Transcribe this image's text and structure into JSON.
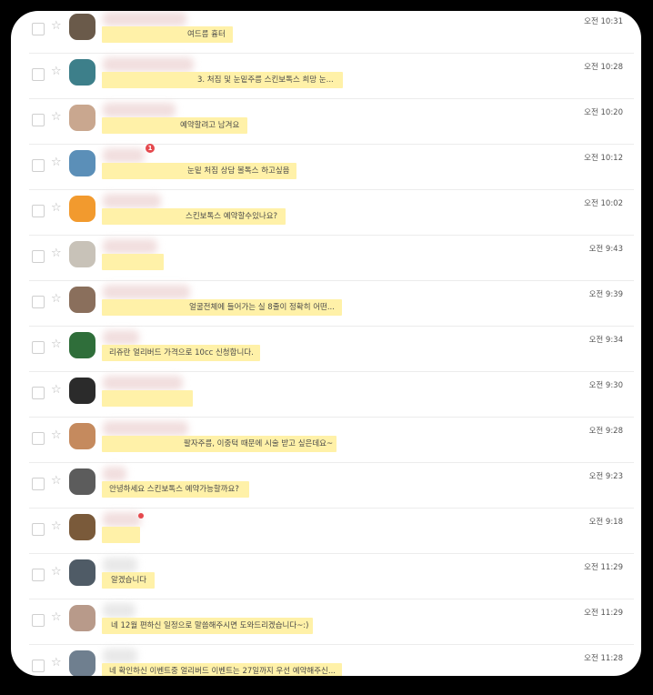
{
  "messages": [
    {
      "text": "여드름 흉터",
      "time": "오전 10:31",
      "avatar": "#6a5a4a",
      "badge": ""
    },
    {
      "text": "3. 처짐 및 눈밑주름 스킨보톡스 희망 눈...",
      "time": "오전 10:28",
      "avatar": "#3d7f8a",
      "badge": ""
    },
    {
      "text": "예약할려고 남겨요",
      "time": "오전 10:20",
      "avatar": "#c9a78f",
      "badge": ""
    },
    {
      "text": "눈밑 처짐 상담 볼톡스 하고싶음",
      "time": "오전 10:12",
      "avatar": "#5b8fb8",
      "badge": "1"
    },
    {
      "text": "스킨보톡스 예약할수있나요?",
      "time": "오전 10:02",
      "avatar": "#f29a2e",
      "badge": ""
    },
    {
      "text": "",
      "time": "오전 9:43",
      "avatar": "#c8c2b8",
      "badge": ""
    },
    {
      "text": "얼굴전체에 들어가는 실 8줄이 정확히 어떤...",
      "time": "오전 9:39",
      "avatar": "#8a6f5c",
      "badge": ""
    },
    {
      "text": "리쥬란 얼리버드 가격으로 10cc 신청합니다.",
      "time": "오전 9:34",
      "avatar": "#2f6e3a",
      "badge": ""
    },
    {
      "text": "",
      "time": "오전 9:30",
      "avatar": "#2b2b2b",
      "badge": ""
    },
    {
      "text": "팔자주름, 이중턱 때문에 시술 받고 싶은데요~",
      "time": "오전 9:28",
      "avatar": "#c58a5e",
      "badge": ""
    },
    {
      "text": "안녕하세요 스킨보톡스 예약가능할까요?",
      "time": "오전 9:23",
      "avatar": "#5c5c5c",
      "badge": ""
    },
    {
      "text": "",
      "time": "오전 9:18",
      "avatar": "#7a5a3a",
      "badge": "dot"
    },
    {
      "text": "알겠습니다",
      "time": "오전 11:29",
      "avatar": "#4f5b66",
      "badge": ""
    },
    {
      "text": "네 12월 편하신 일정으로 말씀해주시면 도와드리겠습니다~:)",
      "time": "오전 11:29",
      "avatar": "#b89a8a",
      "badge": ""
    },
    {
      "text": "네 확인하신 이벤트중 얼리버드 이벤트는 27일까지 우선 예약해주신...",
      "time": "오전 11:28",
      "avatar": "#6f7f8f",
      "badge": ""
    }
  ]
}
